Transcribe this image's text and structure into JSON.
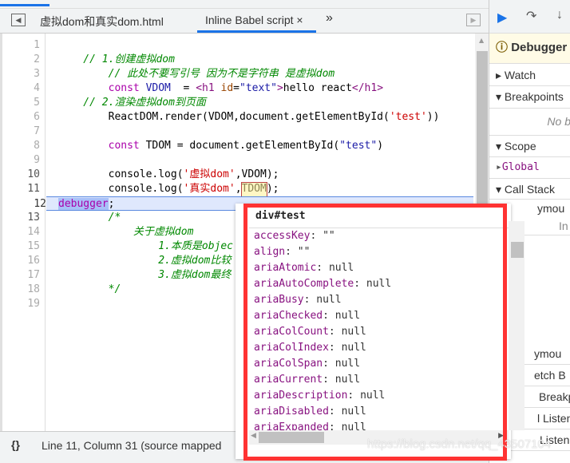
{
  "tabs": {
    "file": "虚拟dom和真实dom.html",
    "active": "Inline Babel script",
    "close": "×",
    "more": "»"
  },
  "code": [
    {
      "n": "1",
      "html": ""
    },
    {
      "n": "2",
      "parts": [
        [
          "c",
          "    // 1.创建虚拟dom"
        ]
      ]
    },
    {
      "n": "3",
      "parts": [
        [
          "c",
          "        // 此处不要写引号 因为不是字符串 是虚拟dom"
        ]
      ]
    },
    {
      "n": "4",
      "parts": [
        [
          "k",
          "        const "
        ],
        [
          "v",
          "VDOM"
        ],
        [
          "",
          "  = "
        ],
        [
          "t",
          "<h1 "
        ],
        [
          "a",
          "id"
        ],
        [
          "",
          "="
        ],
        [
          "v",
          "\"text\""
        ],
        [
          "t",
          ">"
        ],
        [
          "",
          "hello react"
        ],
        [
          "t",
          "</h1>"
        ]
      ]
    },
    {
      "n": "5",
      "parts": [
        [
          "c",
          "    // 2.渲染虚拟dom到页面"
        ]
      ]
    },
    {
      "n": "6",
      "parts": [
        [
          "",
          "        ReactDOM.render(VDOM,document.getElementById("
        ],
        [
          "s",
          "'test'"
        ],
        [
          "",
          "))"
        ]
      ]
    },
    {
      "n": "7",
      "parts": []
    },
    {
      "n": "8",
      "parts": [
        [
          "k",
          "        const "
        ],
        [
          "",
          "TDOM = document.getElementById("
        ],
        [
          "v",
          "\"test\""
        ],
        [
          "",
          ")"
        ]
      ]
    },
    {
      "n": "9",
      "parts": []
    },
    {
      "n": "10",
      "parts": [
        [
          "",
          "        console.log("
        ],
        [
          "s",
          "'虚拟dom'"
        ],
        [
          "",
          ",VDOM);"
        ]
      ]
    },
    {
      "n": "11",
      "parts": [
        [
          "",
          "        console.log("
        ],
        [
          "s",
          "'真实dom'"
        ],
        [
          "",
          ",TDOM);"
        ]
      ]
    },
    {
      "n": "12",
      "parts": [
        [
          "k",
          "        debugger"
        ],
        [
          "",
          ";"
        ]
      ]
    },
    {
      "n": "13",
      "parts": [
        [
          "c",
          "        /*"
        ]
      ]
    },
    {
      "n": "14",
      "parts": [
        [
          "c",
          "            关于虚拟dom"
        ]
      ]
    },
    {
      "n": "15",
      "parts": [
        [
          "c",
          "                1.本质是objec"
        ]
      ]
    },
    {
      "n": "16",
      "parts": [
        [
          "c",
          "                2.虚拟dom比较"
        ]
      ]
    },
    {
      "n": "17",
      "parts": [
        [
          "c",
          "                3.虚拟dom最终"
        ]
      ]
    },
    {
      "n": "18",
      "parts": [
        [
          "c",
          "        */"
        ]
      ]
    },
    {
      "n": "19",
      "parts": []
    }
  ],
  "status": {
    "text": "Line 11, Column 31  (source mapped"
  },
  "right": {
    "debugger": "Debugger",
    "watch": "Watch",
    "breakpoints": "Breakpoints",
    "no_bp": "No b",
    "scope": "Scope",
    "global": "Global",
    "callstack": "Call Stack",
    "frag1": "ymou",
    "frag1b": "In",
    "frag2": "ymou",
    "frag3": "etch B",
    "frag4": "Breakp",
    "frag5": "l Listen",
    "frag6": "Listen"
  },
  "popover": {
    "title": "div#test",
    "props": [
      [
        "accessKey",
        "\"\""
      ],
      [
        "align",
        "\"\""
      ],
      [
        "ariaAtomic",
        "null"
      ],
      [
        "ariaAutoComplete",
        "null"
      ],
      [
        "ariaBusy",
        "null"
      ],
      [
        "ariaChecked",
        "null"
      ],
      [
        "ariaColCount",
        "null"
      ],
      [
        "ariaColIndex",
        "null"
      ],
      [
        "ariaColSpan",
        "null"
      ],
      [
        "ariaCurrent",
        "null"
      ],
      [
        "ariaDescription",
        "null"
      ],
      [
        "ariaDisabled",
        "null"
      ],
      [
        "ariaExpanded",
        "null"
      ]
    ]
  },
  "watermark": "https://blog.csdn.net/qq_43507104",
  "colors": {
    "accent": "#1a73e8",
    "highlight_box": "#ff3333"
  }
}
